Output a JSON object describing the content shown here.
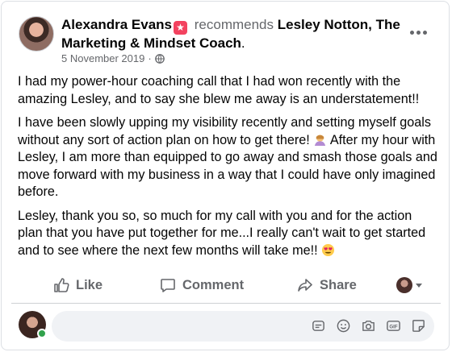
{
  "post": {
    "author": "Alexandra Evans",
    "action": "recommends",
    "page_name": "Lesley Notton, The Marketing & Mindset Coach",
    "punctuation": ".",
    "date": "5 November 2019",
    "separator": "·",
    "audience_icon": "globe-icon",
    "paragraphs": [
      "I had my power-hour coaching call that I had won recently with the amazing Lesley, and to say she blew me away is an understatement!!",
      "I have been slowly upping my visibility recently and setting myself goals without any sort of action plan on how to get there!",
      "After my hour with Lesley, I am more than equipped to go away and smash those goals and move forward with my business in a way that I could have only imagined before.",
      "Lesley, thank you so, so much for my call with you and for the action plan that you have put together for me...I really can't wait to get started and to see where the next few months will take me!!"
    ]
  },
  "actions": {
    "like_label": "Like",
    "comment_label": "Comment",
    "share_label": "Share"
  },
  "composer": {
    "placeholder": "",
    "icons": [
      "sticker-outline-icon",
      "smiley-icon",
      "camera-icon",
      "gif-icon",
      "sticker-icon"
    ]
  },
  "colors": {
    "recommend_badge": "#f3425f",
    "secondary_text": "#65676b",
    "online": "#31a24c",
    "input_bg": "#f0f2f5"
  }
}
